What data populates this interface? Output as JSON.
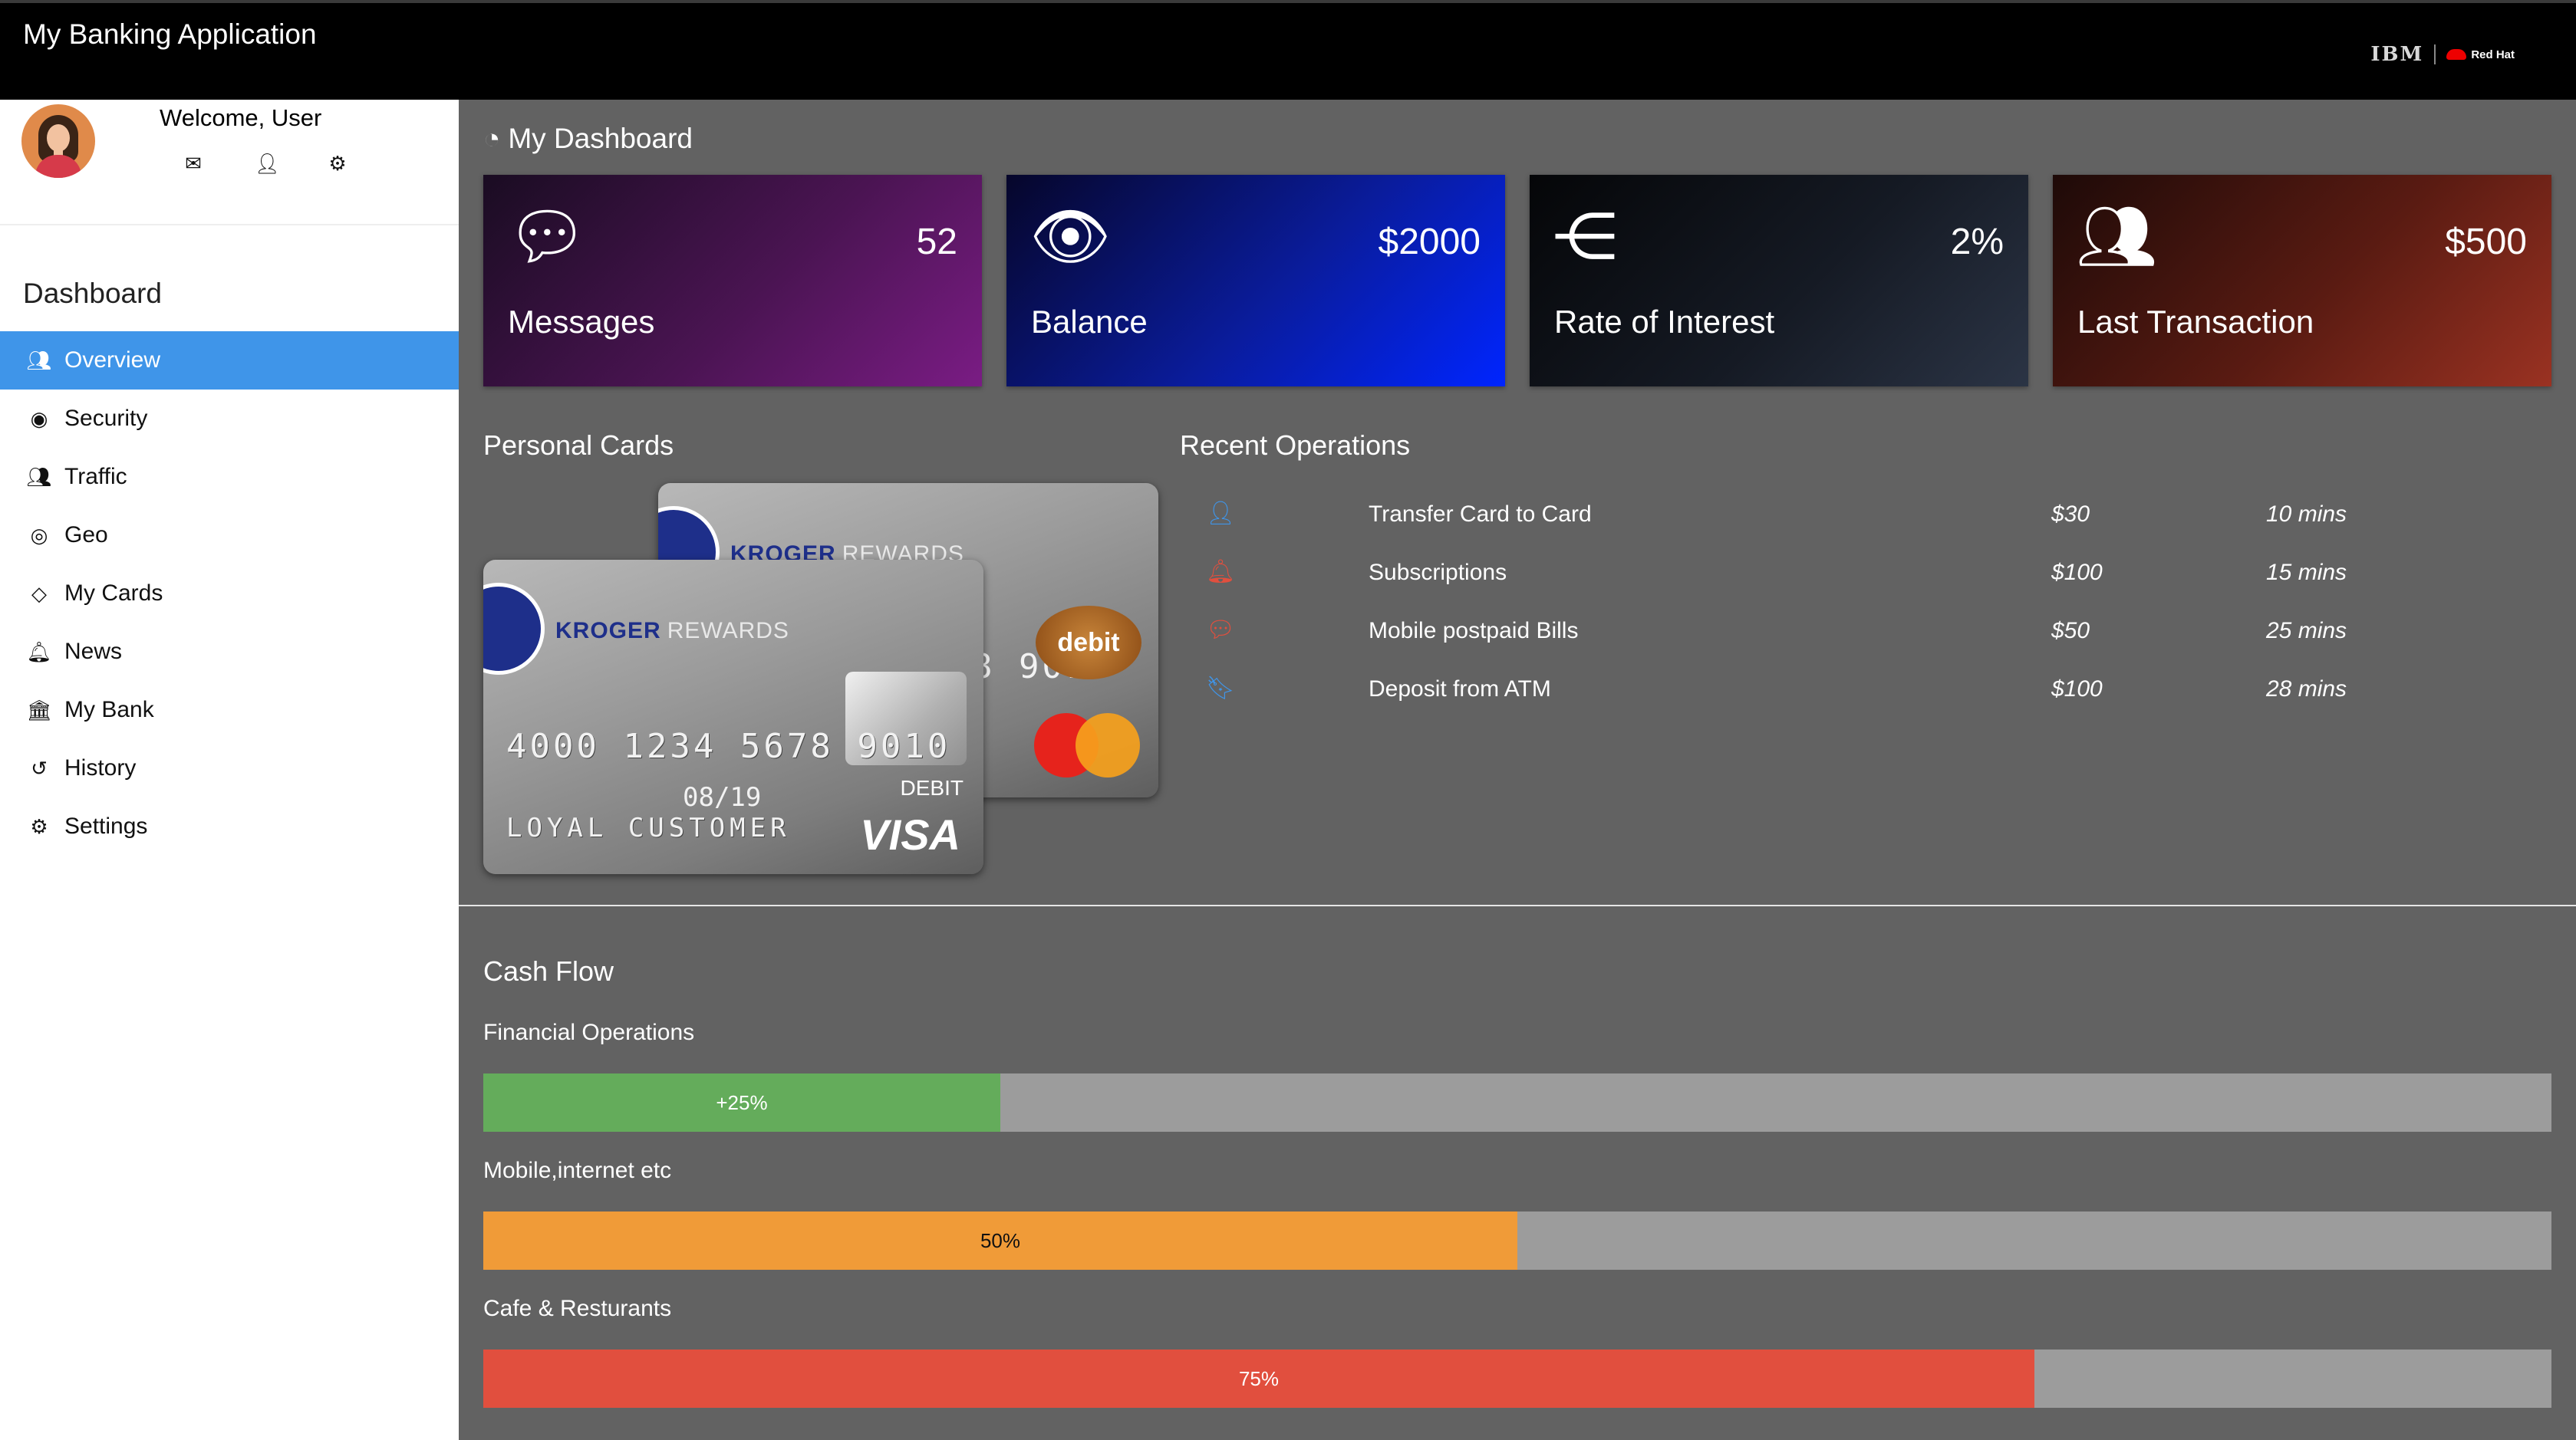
{
  "app": {
    "title": "My Banking Application",
    "brand_ibm": "IBM",
    "brand_redhat": "Red Hat"
  },
  "user": {
    "welcome": "Welcome, User"
  },
  "sidebar": {
    "heading": "Dashboard",
    "items": [
      {
        "label": "Overview",
        "icon": "users-icon",
        "active": true
      },
      {
        "label": "Security",
        "icon": "eye-icon"
      },
      {
        "label": "Traffic",
        "icon": "users-icon"
      },
      {
        "label": "Geo",
        "icon": "target-icon"
      },
      {
        "label": "My Cards",
        "icon": "diamond-icon"
      },
      {
        "label": "News",
        "icon": "bell-icon"
      },
      {
        "label": "My Bank",
        "icon": "bank-icon"
      },
      {
        "label": "History",
        "icon": "history-icon"
      },
      {
        "label": "Settings",
        "icon": "gear-icon"
      }
    ]
  },
  "dashboard": {
    "title": "My Dashboard",
    "tiles": [
      {
        "label": "Messages",
        "value": "52",
        "icon": "chat-icon"
      },
      {
        "label": "Balance",
        "value": "$2000",
        "icon": "eye-icon"
      },
      {
        "label": "Rate of Interest",
        "value": "2%",
        "icon": "share-icon"
      },
      {
        "label": "Last Transaction",
        "value": "$500",
        "icon": "users-icon"
      }
    ]
  },
  "cards": {
    "title": "Personal Cards",
    "front": {
      "brand": "KROGER",
      "program": "REWARDS",
      "number": "4000 1234 5678 9010",
      "valid_thru": "08/19",
      "holder": "LOYAL CUSTOMER",
      "type": "DEBIT",
      "network": "VISA"
    },
    "back": {
      "brand": "KROGER",
      "program": "REWARDS",
      "badge": "debit",
      "number_partial": "8 9010"
    }
  },
  "operations": {
    "title": "Recent Operations",
    "rows": [
      {
        "name": "Transfer Card to Card",
        "amount": "$30",
        "time": "10 mins",
        "icon": "user-icon",
        "color": "#3f95e9"
      },
      {
        "name": "Subscriptions",
        "amount": "$100",
        "time": "15 mins",
        "icon": "bell-icon",
        "color": "#e14f3e"
      },
      {
        "name": "Mobile postpaid Bills",
        "amount": "$50",
        "time": "25 mins",
        "icon": "chat-icon",
        "color": "#e14f3e"
      },
      {
        "name": "Deposit from ATM",
        "amount": "$100",
        "time": "28 mins",
        "icon": "bookmark-icon",
        "color": "#3f95e9"
      }
    ]
  },
  "cashflow": {
    "title": "Cash Flow",
    "bars": [
      {
        "label": "Financial Operations",
        "text": "+25%",
        "percent": 25,
        "color": "#64ac5b"
      },
      {
        "label": "Mobile,internet etc",
        "text": "50%",
        "percent": 50,
        "color": "#f09b38"
      },
      {
        "label": "Cafe & Resturants",
        "text": "75%",
        "percent": 75,
        "color": "#e14f3e"
      }
    ]
  }
}
